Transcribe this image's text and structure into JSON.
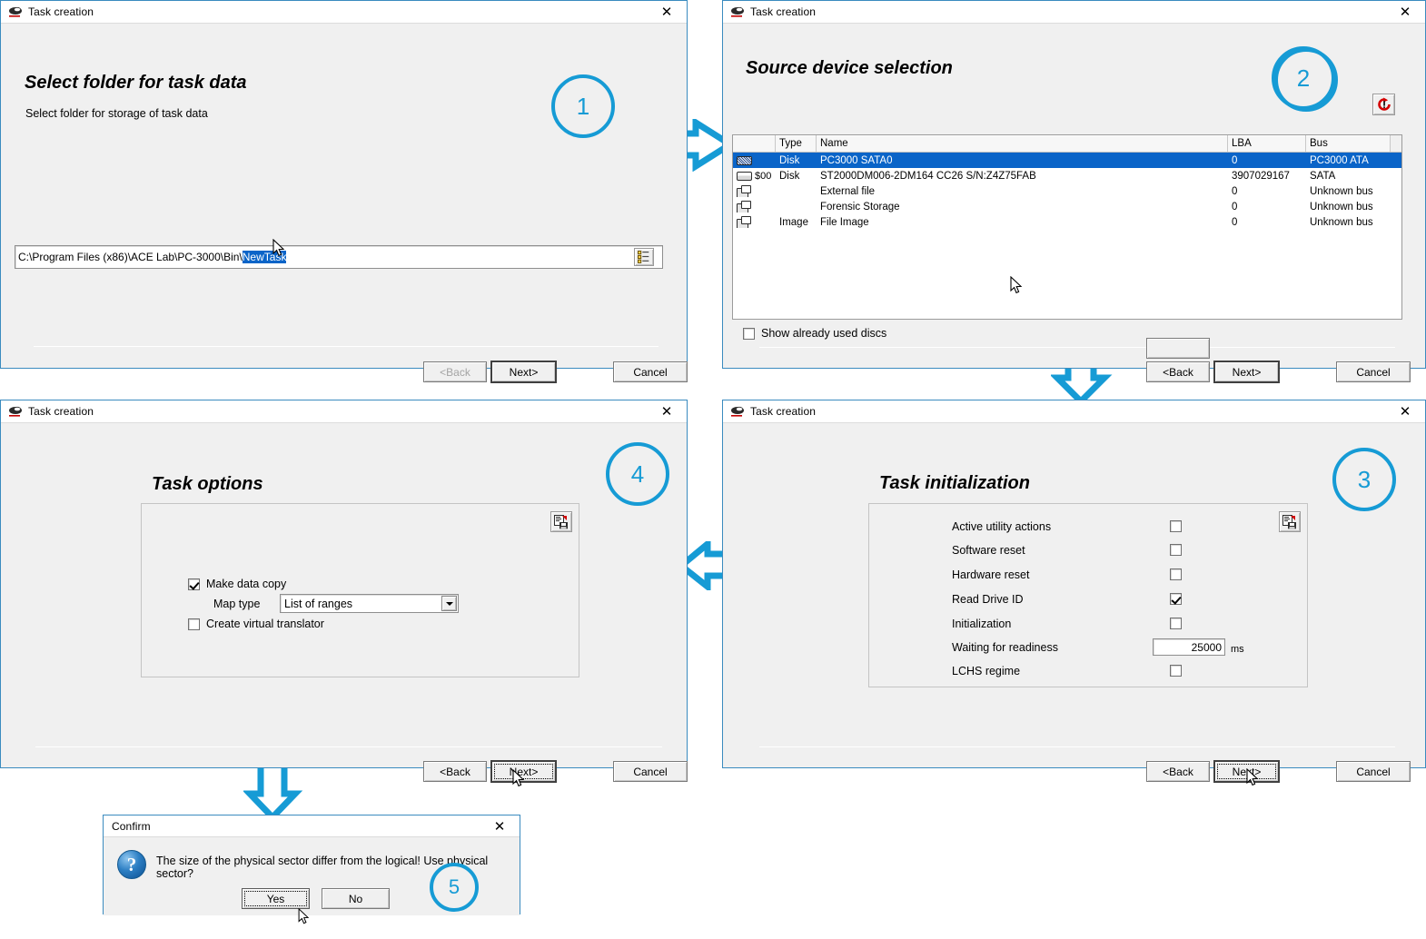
{
  "panel1": {
    "window_title": "Task creation",
    "close_label": "✕",
    "heading": "Select folder for task data",
    "subheading": "Select folder for storage of task data",
    "path_prefix": "C:\\Program Files (x86)\\ACE Lab\\PC-3000\\Bin\\",
    "path_selected": "NewTask",
    "browse_icon": "folder-tree-icon",
    "buttons": {
      "back": "<Back",
      "next": "Next>",
      "cancel": "Cancel"
    },
    "back_disabled": true,
    "step_number": "1"
  },
  "panel2": {
    "window_title": "Task creation",
    "close_label": "✕",
    "heading": "Source device selection",
    "refresh_icon": "red-rescan-icon",
    "step_number": "2",
    "columns": [
      "",
      "Type",
      "Name",
      "LBA",
      "Bus"
    ],
    "rows": [
      {
        "icon": "disk-hatch-icon",
        "tag": "",
        "type": "Disk",
        "name": "PC3000 SATA0",
        "lba": "0",
        "bus": "PC3000 ATA",
        "selected": true
      },
      {
        "icon": "disk-plain-icon",
        "tag": "$00",
        "type": "Disk",
        "name": "ST2000DM006-2DM164 CC26 S/N:Z4Z75FAB",
        "lba": "3907029167",
        "bus": "SATA",
        "selected": false
      },
      {
        "icon": "file-device-icon",
        "tag": "",
        "type": "",
        "name": "External file",
        "lba": "0",
        "bus": "Unknown bus",
        "selected": false
      },
      {
        "icon": "file-device-icon",
        "tag": "",
        "type": "",
        "name": "Forensic Storage",
        "lba": "0",
        "bus": "Unknown bus",
        "selected": false
      },
      {
        "icon": "file-device-icon",
        "tag": "",
        "type": "Image",
        "name": "File Image",
        "lba": "0",
        "bus": "Unknown bus",
        "selected": false
      }
    ],
    "show_used_discs_label": "Show already used discs",
    "show_used_discs_checked": false,
    "buttons": {
      "back": "<Back",
      "next": "Next>",
      "cancel": "Cancel"
    }
  },
  "panel3": {
    "window_title": "Task creation",
    "close_label": "✕",
    "heading": "Task initialization",
    "save_icon": "save-preset-icon",
    "step_number": "3",
    "options": [
      {
        "label": "Active utility actions",
        "checked": false
      },
      {
        "label": "Software reset",
        "checked": false
      },
      {
        "label": "Hardware reset",
        "checked": false
      },
      {
        "label": "Read Drive ID",
        "checked": true
      },
      {
        "label": "Initialization",
        "checked": false
      }
    ],
    "waiting_label": "Waiting for readiness",
    "waiting_value": "25000",
    "waiting_units": "ms",
    "lchs_label": "LCHS regime",
    "lchs_checked": false,
    "buttons": {
      "back": "<Back",
      "next": "Next>",
      "cancel": "Cancel"
    }
  },
  "panel4": {
    "window_title": "Task creation",
    "close_label": "✕",
    "heading": "Task options",
    "save_icon": "save-preset-icon",
    "step_number": "4",
    "make_data_copy_label": "Make data copy",
    "make_data_copy_checked": true,
    "map_type_label": "Map type",
    "map_type_value": "List of ranges",
    "create_translator_label": "Create virtual translator",
    "create_translator_checked": false,
    "buttons": {
      "back": "<Back",
      "next": "Next>",
      "cancel": "Cancel"
    }
  },
  "confirm": {
    "window_title": "Confirm",
    "close_label": "✕",
    "icon": "question-icon",
    "message": "The size of the physical sector differ from the logical! Use physical sector?",
    "yes_label": "Yes",
    "no_label": "No",
    "step_number": "5"
  },
  "colors": {
    "accent": "#169bd5",
    "selection": "#0a64c8",
    "window_border": "#3a8bbf",
    "dialog_face": "#f0f0f0"
  }
}
